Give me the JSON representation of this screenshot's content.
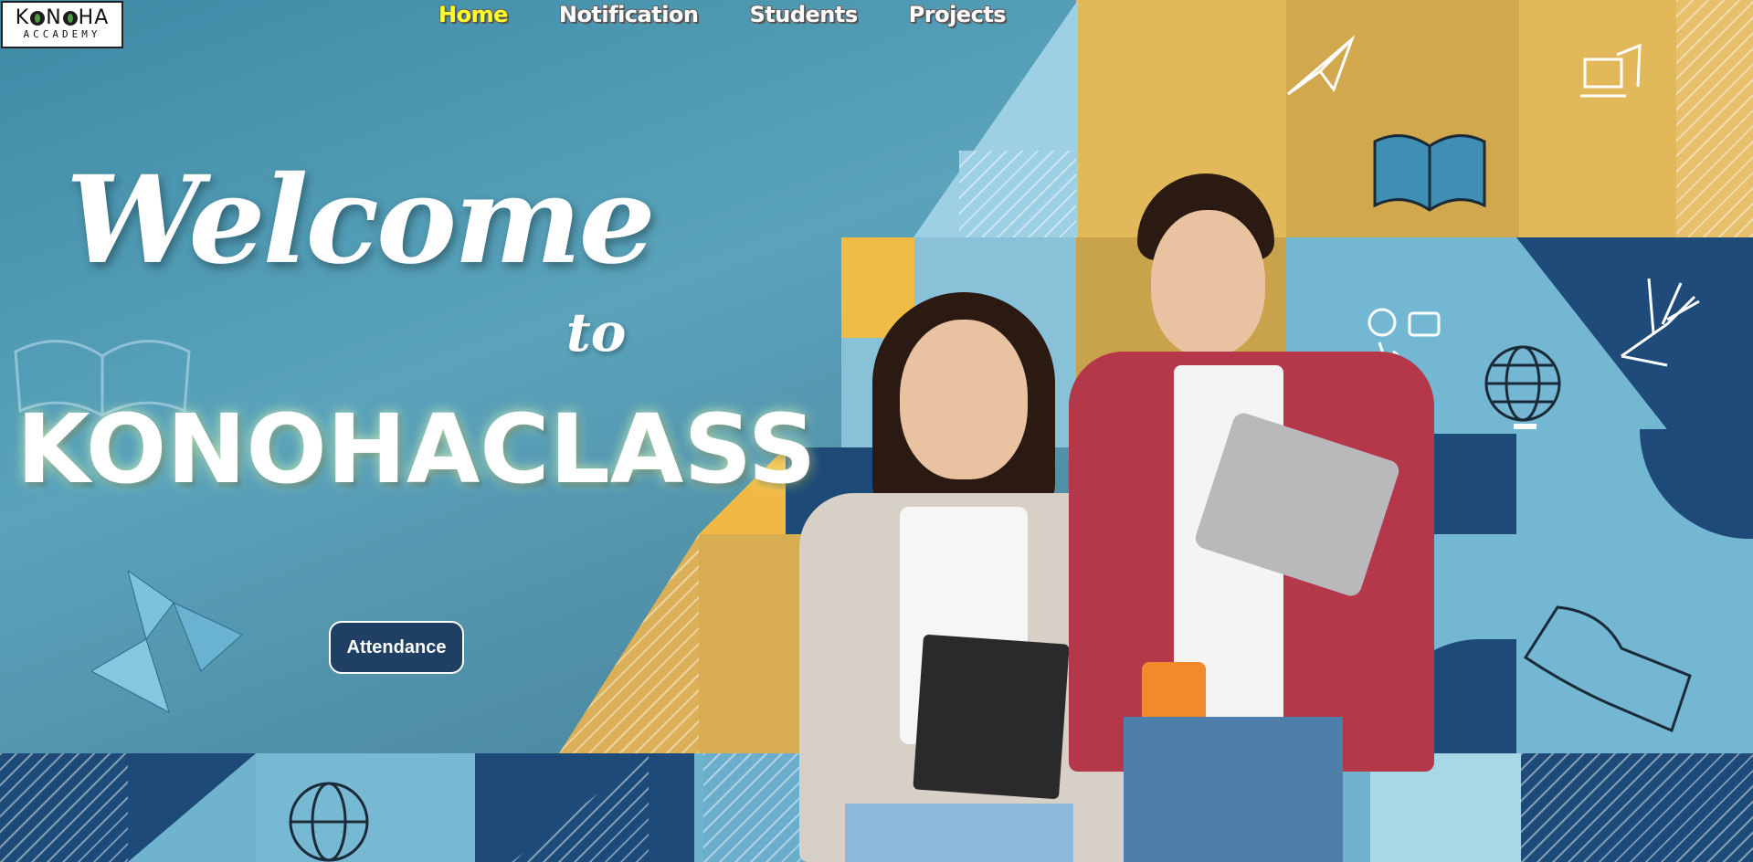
{
  "logo": {
    "line1_a": "K",
    "line1_b": "N",
    "line1_c": "HA",
    "line2": "ACCADEMY"
  },
  "nav": [
    {
      "label": "Home",
      "active": true
    },
    {
      "label": "Notification",
      "active": false
    },
    {
      "label": "Students",
      "active": false
    },
    {
      "label": "Projects",
      "active": false
    }
  ],
  "hero": {
    "welcome": "Welcome",
    "to": "to",
    "brand": "KONOHACLASS",
    "button": "Attendance"
  },
  "colors": {
    "active_nav": "#ffff2a",
    "button_bg": "#1f3f63",
    "navy": "#1d4a78",
    "gold": "#e3b956",
    "sky": "#8fc9de"
  }
}
